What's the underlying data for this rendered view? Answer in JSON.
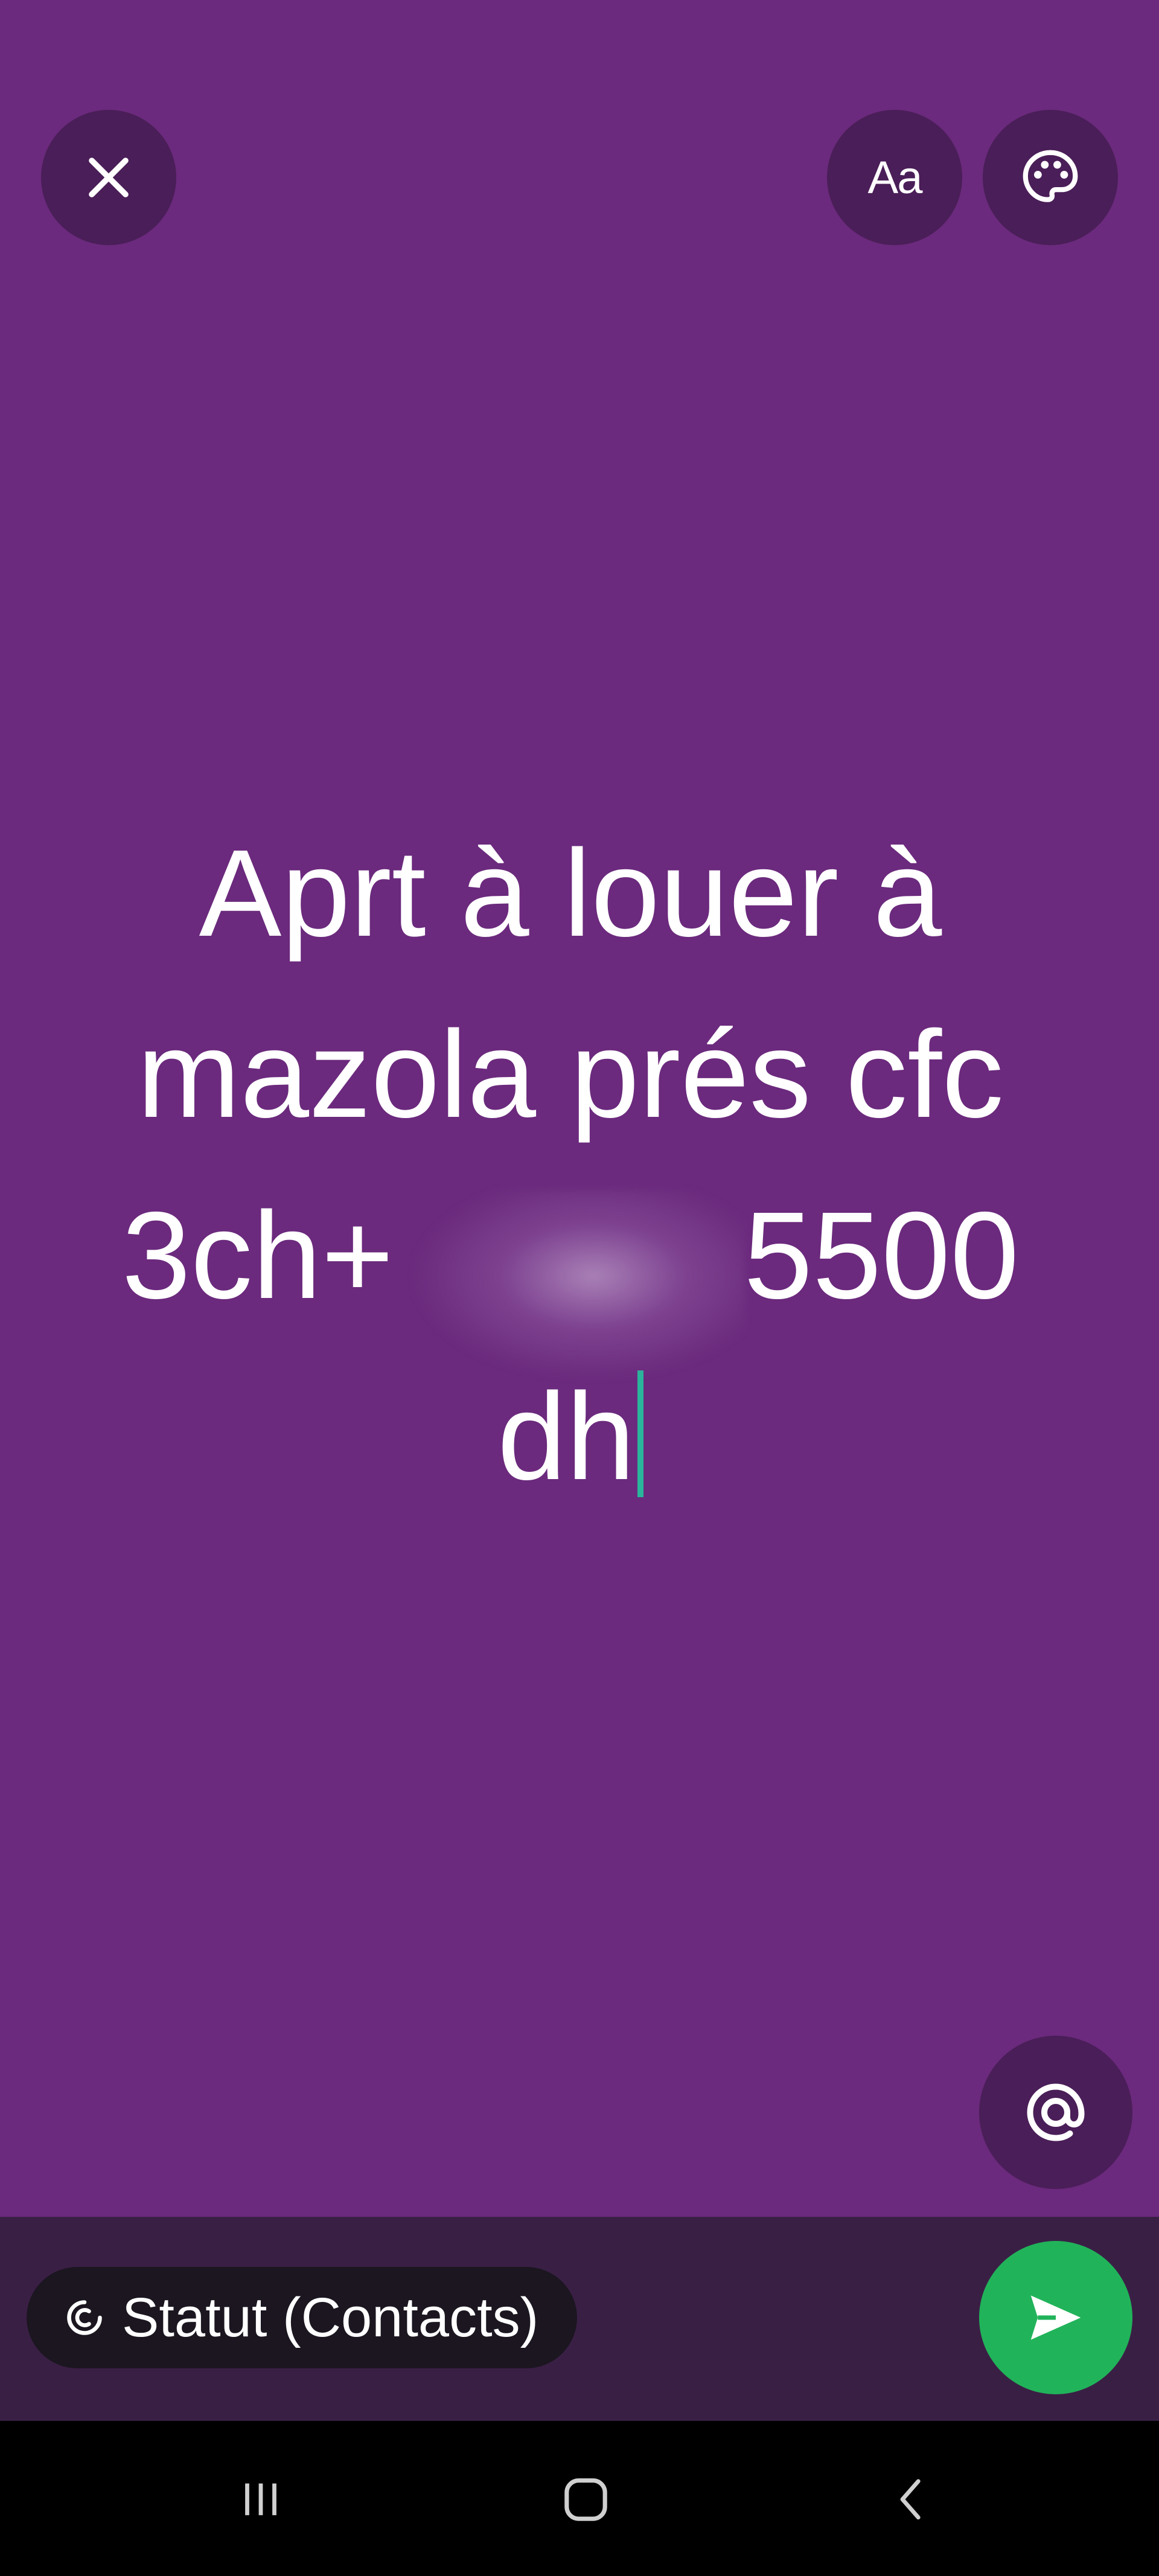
{
  "status_editor": {
    "text_lines": [
      "Aprt à louer à",
      "mazola prés cfc",
      "3ch+",
      "5500",
      "dh"
    ],
    "background_color": "#6b2a7d"
  },
  "toolbar": {
    "close_icon": "close-icon",
    "font_label": "Aa",
    "palette_icon": "palette-icon",
    "mention_icon": "at-sign-icon"
  },
  "footer": {
    "audience_icon": "contacts-status-icon",
    "audience_label": "Statut (Contacts)",
    "send_icon": "send-icon",
    "send_color": "#21b35a"
  },
  "system_nav": {
    "recents_icon": "recents-icon",
    "home_icon": "home-icon",
    "back_icon": "back-icon"
  }
}
